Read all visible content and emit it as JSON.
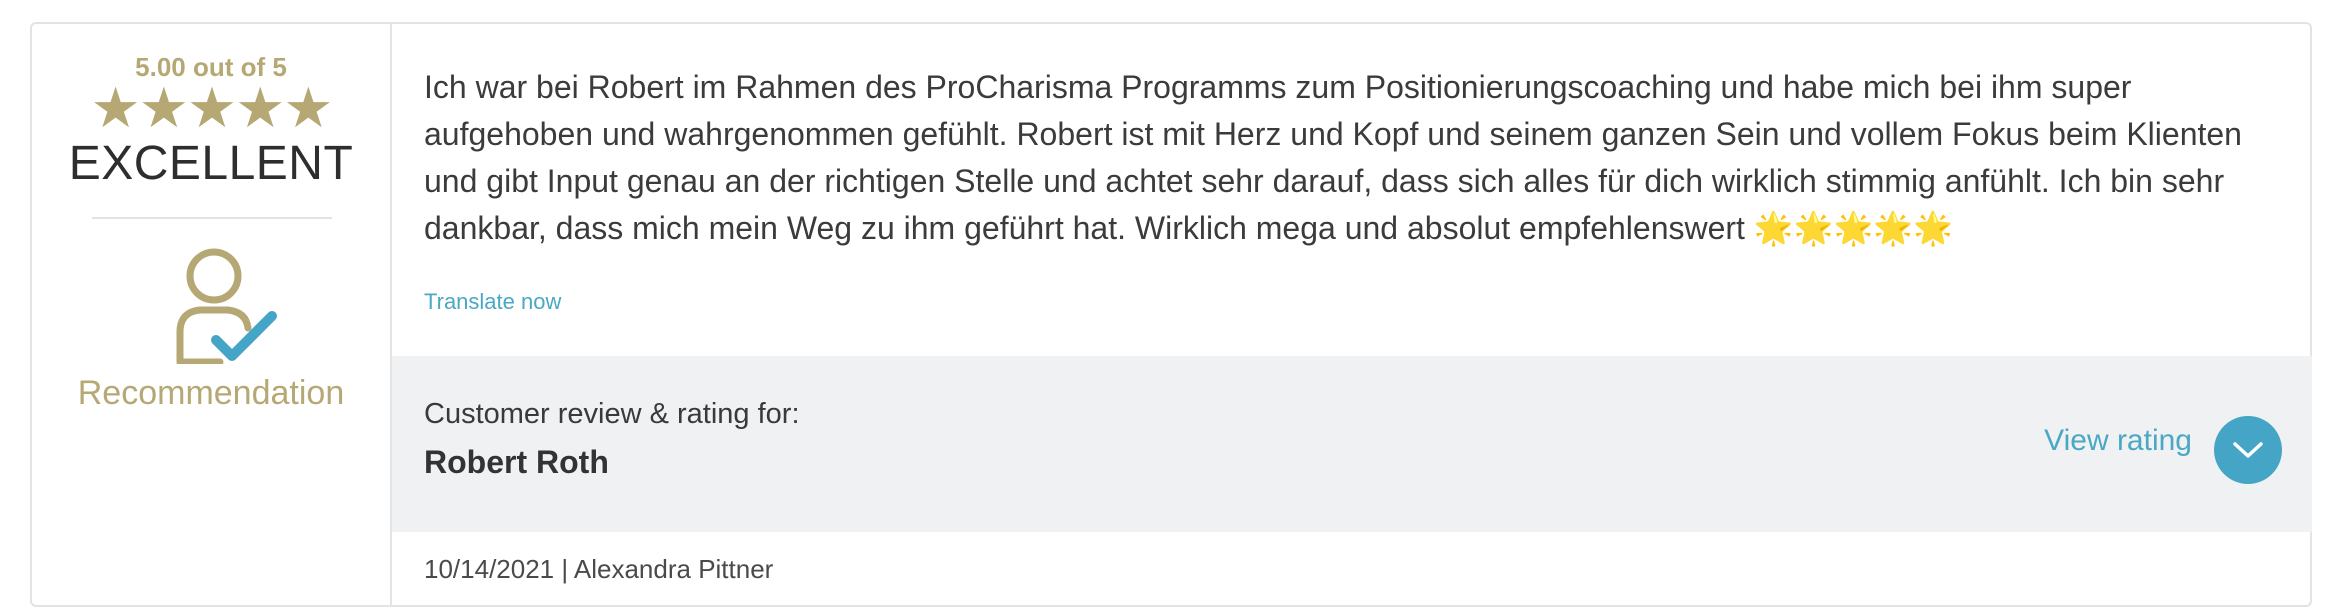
{
  "summary": {
    "score_text": "5.00 out of 5",
    "stars": 5,
    "rating_word": "EXCELLENT",
    "recommendation_label": "Recommendation"
  },
  "review": {
    "text": "Ich war bei Robert im Rahmen des ProCharisma Programms zum Positionierungscoaching und habe mich bei ihm super aufgehoben und wahrgenommen gefühlt. Robert ist mit Herz und Kopf und seinem ganzen Sein und vollem Fokus beim Klienten und gibt Input genau an der richtigen Stelle und achtet sehr darauf, dass sich alles für dich wirklich stimmig anfühlt. Ich bin sehr dankbar, dass mich mein Weg zu ihm geführt hat. Wirklich mega und absolut empfehlenswert 🌟🌟🌟🌟🌟",
    "translate_label": "Translate now"
  },
  "footer": {
    "caption": "Customer review & rating for:",
    "name": "Robert Roth",
    "view_rating_label": "View rating"
  },
  "meta": {
    "date_author": "10/14/2021 | Alexandra Pittner"
  },
  "colors": {
    "gold": "#b6a874",
    "accent_blue": "#45a5c6",
    "band_gray": "#f0f1f3"
  },
  "icons": {
    "stars": "star-icon",
    "recommendation": "person-check-icon",
    "expand": "chevron-down-icon"
  }
}
